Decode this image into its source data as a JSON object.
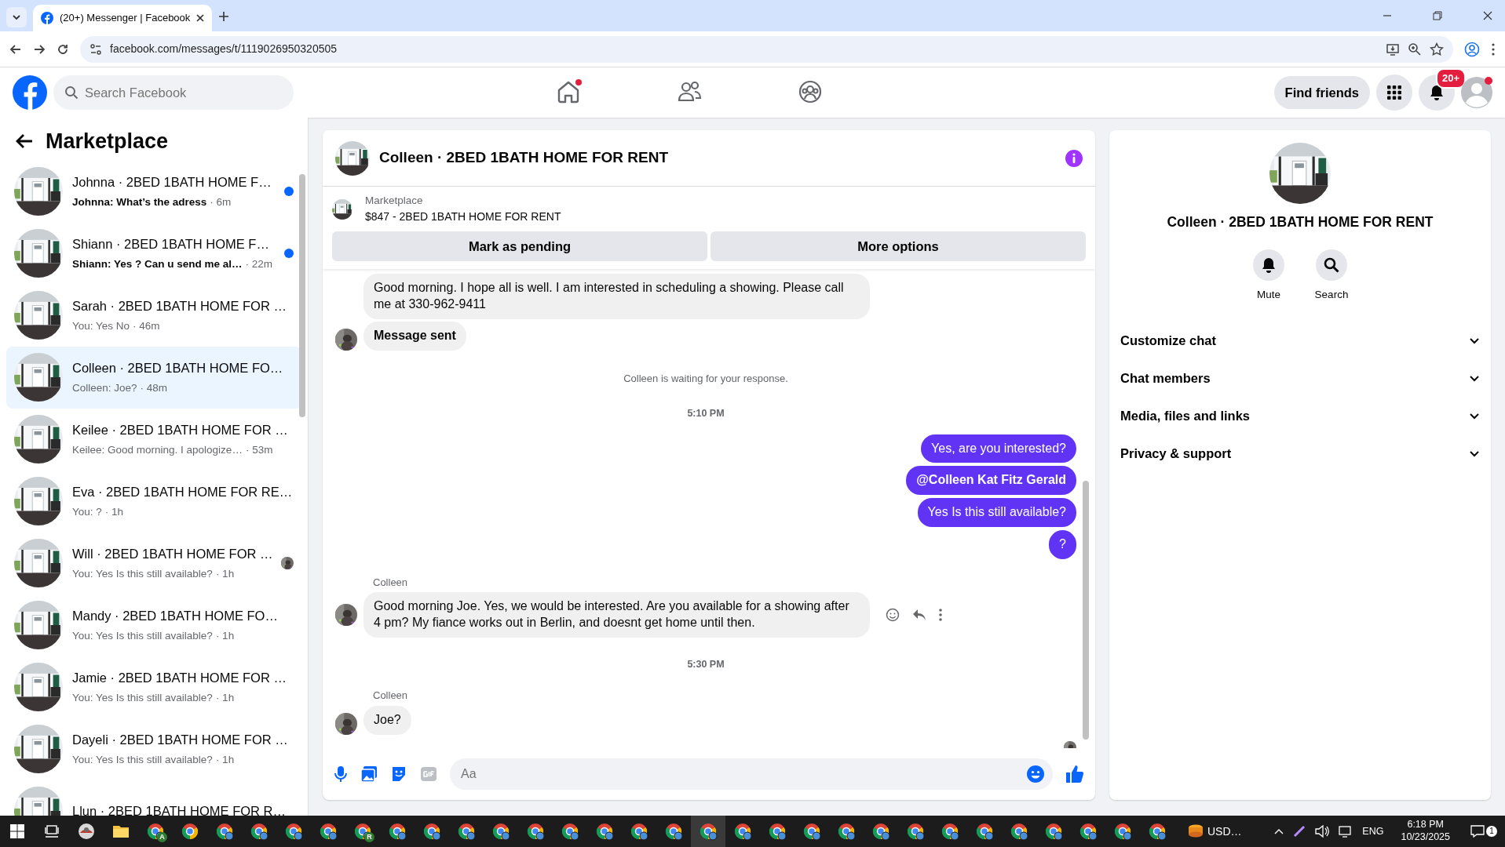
{
  "browser": {
    "tab_title": "(20+) Messenger | Facebook",
    "url": "facebook.com/messages/t/1119026950320505"
  },
  "topbar": {
    "search_placeholder": "Search Facebook",
    "nav": [
      {
        "kind": "home",
        "dot": true
      },
      {
        "kind": "friends",
        "dot": false
      },
      {
        "kind": "groups",
        "dot": false
      }
    ],
    "find_friends": "Find friends",
    "notification_badge": "20+",
    "account_dot": true
  },
  "sidebar": {
    "title": "Marketplace",
    "chats": [
      {
        "name": "Johnna · 2BED 1BATH HOME F…",
        "preview": "Johnna: What’s the adress",
        "time": "· 6m",
        "unread": true,
        "selected": false,
        "seen_avatar": false
      },
      {
        "name": "Shiann · 2BED 1BATH HOME F…",
        "preview": "Shiann: Yes ? Can u send me al…",
        "time": "· 22m",
        "unread": true,
        "selected": false,
        "seen_avatar": false
      },
      {
        "name": "Sarah · 2BED 1BATH HOME FOR …",
        "preview": "You: Yes No",
        "time": "· 46m",
        "unread": false,
        "selected": false,
        "seen_avatar": false
      },
      {
        "name": "Colleen · 2BED 1BATH HOME FO…",
        "preview": "Colleen: Joe?",
        "time": "· 48m",
        "unread": false,
        "selected": true,
        "seen_avatar": false
      },
      {
        "name": "Keilee · 2BED 1BATH HOME FOR …",
        "preview": "Keilee: Good morning. I apologize…",
        "time": "· 53m",
        "unread": false,
        "selected": false,
        "seen_avatar": false
      },
      {
        "name": "Eva · 2BED 1BATH HOME FOR RE…",
        "preview": "You: ?",
        "time": "· 1h",
        "unread": false,
        "selected": false,
        "seen_avatar": false
      },
      {
        "name": "Will · 2BED 1BATH HOME FOR …",
        "preview": "You: Yes Is this still available?",
        "time": "· 1h",
        "unread": false,
        "selected": false,
        "seen_avatar": true
      },
      {
        "name": "Mandy · 2BED 1BATH HOME FO…",
        "preview": "You: Yes Is this still available?",
        "time": "· 1h",
        "unread": false,
        "selected": false,
        "seen_avatar": false
      },
      {
        "name": "Jamie · 2BED 1BATH HOME FOR …",
        "preview": "You: Yes Is this still available?",
        "time": "· 1h",
        "unread": false,
        "selected": false,
        "seen_avatar": false
      },
      {
        "name": "Dayeli · 2BED 1BATH HOME FOR …",
        "preview": "You: Yes Is this still available?",
        "time": "· 1h",
        "unread": false,
        "selected": false,
        "seen_avatar": false
      },
      {
        "name": "Llun · 2BED 1BATH HOME FOR R…",
        "unread": false,
        "selected": false,
        "seen_avatar": false
      }
    ]
  },
  "chat": {
    "title": "Colleen · 2BED 1BATH HOME FOR RENT",
    "listing": {
      "label": "Marketplace",
      "title": "$847 - 2BED 1BATH HOME FOR RENT"
    },
    "buttons": [
      "Mark as pending",
      "More options"
    ],
    "messages": [
      {
        "kind": "incoming",
        "text": "Good morning. I hope all is well. I am interested in scheduling a showing. Please call me at 330-962-9411",
        "bold": false,
        "avatar": false,
        "actions": false
      },
      {
        "kind": "incoming",
        "text": "Message sent",
        "bold": true,
        "avatar": true,
        "actions": false
      },
      {
        "kind": "notice",
        "text": "Colleen is waiting for your response."
      },
      {
        "kind": "time",
        "text": "5:10 PM"
      },
      {
        "kind": "outgoing",
        "text": "Yes, are you interested?",
        "bold": false
      },
      {
        "kind": "outgoing",
        "text": "@Colleen Kat Fitz Gerald",
        "bold": true
      },
      {
        "kind": "outgoing",
        "text": "Yes Is this still available?",
        "bold": false
      },
      {
        "kind": "outgoing",
        "text": "?",
        "bold": false
      },
      {
        "kind": "sender",
        "text": "Colleen"
      },
      {
        "kind": "incoming",
        "text": "Good morning Joe. Yes, we would be interested. Are you available for a showing after 4 pm? My fiance works out in Berlin, and doesnt get home until then.",
        "bold": false,
        "avatar": true,
        "actions": true
      },
      {
        "kind": "time",
        "text": "5:30 PM"
      },
      {
        "kind": "sender",
        "text": "Colleen"
      },
      {
        "kind": "incoming",
        "text": "Joe?",
        "bold": false,
        "avatar": true,
        "actions": false
      },
      {
        "kind": "seen"
      }
    ],
    "composer": {
      "placeholder": "Aa"
    }
  },
  "details": {
    "title": "Colleen · 2BED 1BATH HOME FOR RENT",
    "actions": [
      {
        "kind": "mute",
        "label": "Mute"
      },
      {
        "kind": "search",
        "label": "Search"
      }
    ],
    "sections": [
      {
        "label": "Customize chat",
        "expanded": false
      },
      {
        "label": "Chat members",
        "expanded": false
      },
      {
        "label": "Media, files and links",
        "expanded": false
      },
      {
        "label": "Privacy & support",
        "expanded": false
      }
    ]
  },
  "taskbar": {
    "apps": [
      {
        "kind": "app",
        "selected": false
      },
      {
        "kind": "folder",
        "selected": false
      },
      {
        "kind": "browser",
        "badge": "A",
        "selected": false
      },
      {
        "kind": "browser-plain",
        "selected": false
      },
      {
        "kind": "browser",
        "selected": false
      },
      {
        "kind": "browser",
        "selected": false
      },
      {
        "kind": "browser",
        "selected": false
      },
      {
        "kind": "browser",
        "selected": false
      },
      {
        "kind": "browser",
        "badge": "R",
        "selected": false
      },
      {
        "kind": "browser",
        "selected": false
      },
      {
        "kind": "browser",
        "selected": false
      },
      {
        "kind": "browser",
        "selected": false
      },
      {
        "kind": "browser",
        "selected": false
      },
      {
        "kind": "browser",
        "selected": false
      },
      {
        "kind": "browser",
        "selected": false
      },
      {
        "kind": "browser",
        "selected": false
      },
      {
        "kind": "browser",
        "selected": false
      },
      {
        "kind": "browser",
        "selected": false
      },
      {
        "kind": "browser",
        "selected": true
      },
      {
        "kind": "browser",
        "selected": false
      },
      {
        "kind": "browser",
        "selected": false
      },
      {
        "kind": "browser",
        "selected": false
      },
      {
        "kind": "browser",
        "selected": false
      },
      {
        "kind": "browser",
        "selected": false
      },
      {
        "kind": "browser",
        "selected": false
      },
      {
        "kind": "browser",
        "selected": false
      },
      {
        "kind": "browser",
        "selected": false
      },
      {
        "kind": "browser",
        "selected": false
      },
      {
        "kind": "browser",
        "selected": false
      },
      {
        "kind": "browser",
        "selected": false
      },
      {
        "kind": "browser",
        "selected": false
      },
      {
        "kind": "browser",
        "selected": false
      }
    ],
    "tray_text": "USD…",
    "language": "ENG",
    "time": "6:18 PM",
    "date": "10/23/2025",
    "notifications": "1"
  }
}
